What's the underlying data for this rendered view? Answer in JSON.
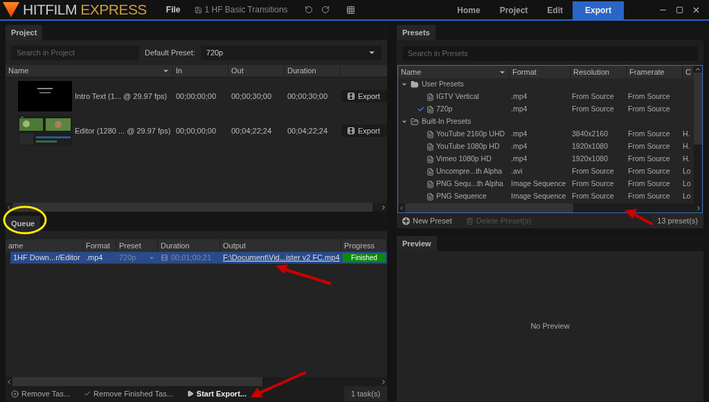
{
  "app": {
    "logo_primary": "HITFILM",
    "logo_secondary": "EXPRESS",
    "menu": "File",
    "project_name": "1 HF Basic Transitions"
  },
  "nav_tabs": [
    {
      "label": "Home",
      "selected": false
    },
    {
      "label": "Project",
      "selected": false
    },
    {
      "label": "Edit",
      "selected": false
    },
    {
      "label": "Export",
      "selected": true
    }
  ],
  "project_panel": {
    "tab": "Project",
    "search_placeholder": "Search in Project",
    "default_preset_label": "Default Preset:",
    "default_preset_value": "720p",
    "columns": [
      "Name",
      "In",
      "Out",
      "Duration"
    ],
    "rows": [
      {
        "name": "Intro Text (1... @ 29.97 fps)",
        "in": "00;00;00;00",
        "out": "00;00;30;00",
        "duration": "00;00;30;00",
        "action": "Export"
      },
      {
        "name": "Editor (1280 ... @ 29.97 fps)",
        "in": "00;00;00;00",
        "out": "00;04;22;24",
        "duration": "00;04;22;24",
        "action": "Export"
      }
    ]
  },
  "queue_panel": {
    "tab": "Queue",
    "columns": [
      "ame",
      "Format",
      "Preset",
      "Duration",
      "Output",
      "Progress"
    ],
    "rows": [
      {
        "name": "1HF Down...r/Editor",
        "format": ".mp4",
        "preset": "720p",
        "duration": "00;01;00;21",
        "output": "F:\\Document\\Vid...ister v2 FC.mp4",
        "progress": "Finished",
        "level": 1,
        "selected": true
      }
    ],
    "buttons": [
      {
        "kind": "remove",
        "label": "Remove Tas..."
      },
      {
        "kind": "finished",
        "label": "Remove Finished Tas..."
      },
      {
        "kind": "start",
        "label": "Start Export..."
      }
    ],
    "task_count": "1 task(s)"
  },
  "presets_panel": {
    "tab": "Presets",
    "search_placeholder": "Search in Presets",
    "columns": [
      "Name",
      "Format",
      "Resolution",
      "Framerate",
      "C"
    ],
    "tree": [
      {
        "name": "User Presets",
        "expanded": true,
        "children": [
          {
            "name": "IGTV Vertical",
            "format": ".mp4",
            "resolution": "From Source",
            "framerate": "From Source",
            "checked": false
          },
          {
            "name": "720p",
            "format": ".mp4",
            "resolution": "From Source",
            "framerate": "From Source",
            "checked": true
          }
        ]
      },
      {
        "name": "Built-In Presets",
        "expanded": true,
        "children": [
          {
            "name": "YouTube 2160p UHD",
            "format": ".mp4",
            "resolution": "3840x2160",
            "framerate": "From Source",
            "column_5": "H.",
            "checked": false
          },
          {
            "name": "YouTube 1080p HD",
            "format": ".mp4",
            "resolution": "1920x1080",
            "framerate": "From Source",
            "column_5": "H.",
            "checked": false
          },
          {
            "name": "Vimeo 1080p HD",
            "format": ".mp4",
            "resolution": "1920x1080",
            "framerate": "From Source",
            "column_5": "H.",
            "checked": false
          },
          {
            "name": "Uncompre...th Alpha",
            "format": ".avi",
            "resolution": "From Source",
            "framerate": "From Source",
            "column_5": "Lo",
            "checked": false
          },
          {
            "name": "PNG Sequ...th Alpha",
            "format": "Image Sequence",
            "resolution": "From Source",
            "framerate": "From Source",
            "column_5": "Lo",
            "checked": false
          },
          {
            "name": "PNG Sequence",
            "format": "Image Sequence",
            "resolution": "From Source",
            "framerate": "From Source",
            "column_5": "Lo",
            "checked": false
          }
        ]
      }
    ],
    "new_button": "New Preset",
    "delete_button": {
      "label": "Delete Preset(s)",
      "disabled": true
    },
    "count": "13 preset(s)"
  },
  "preview_panel": {
    "tab": "Preview",
    "message": "No Preview"
  }
}
